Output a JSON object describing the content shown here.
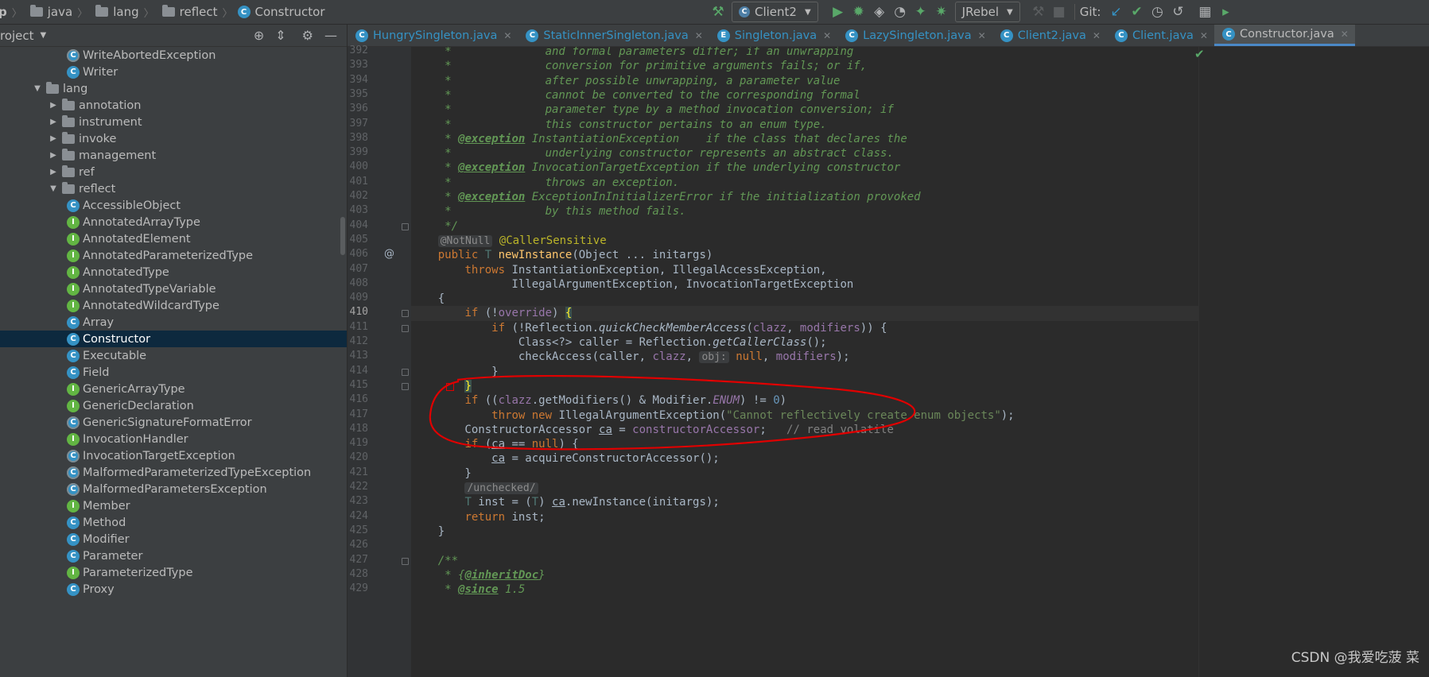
{
  "breadcrumbs": [
    "p",
    "java",
    "lang",
    "reflect",
    "Constructor"
  ],
  "toolbar": {
    "run_config": "Client2",
    "jrebel": "JRebel",
    "git_label": "Git:"
  },
  "project_panel": {
    "title": "roject",
    "tree": [
      {
        "label": "WriteAbortedException",
        "icon": "exception-class",
        "glyph": "C",
        "depth": 4,
        "arrow": ""
      },
      {
        "label": "Writer",
        "icon": "abstract-class",
        "glyph": "C",
        "depth": 4,
        "arrow": ""
      },
      {
        "label": "lang",
        "icon": "package",
        "glyph": "",
        "depth": 2,
        "arrow": "▼"
      },
      {
        "label": "annotation",
        "icon": "package",
        "glyph": "",
        "depth": 3,
        "arrow": "▶"
      },
      {
        "label": "instrument",
        "icon": "package",
        "glyph": "",
        "depth": 3,
        "arrow": "▶"
      },
      {
        "label": "invoke",
        "icon": "package",
        "glyph": "",
        "depth": 3,
        "arrow": "▶"
      },
      {
        "label": "management",
        "icon": "package",
        "glyph": "",
        "depth": 3,
        "arrow": "▶"
      },
      {
        "label": "ref",
        "icon": "package",
        "glyph": "",
        "depth": 3,
        "arrow": "▶"
      },
      {
        "label": "reflect",
        "icon": "package",
        "glyph": "",
        "depth": 3,
        "arrow": "▼"
      },
      {
        "label": "AccessibleObject",
        "icon": "class",
        "glyph": "C",
        "depth": 4,
        "arrow": ""
      },
      {
        "label": "AnnotatedArrayType",
        "icon": "interface",
        "glyph": "I",
        "depth": 4,
        "arrow": ""
      },
      {
        "label": "AnnotatedElement",
        "icon": "interface",
        "glyph": "I",
        "depth": 4,
        "arrow": ""
      },
      {
        "label": "AnnotatedParameterizedType",
        "icon": "interface",
        "glyph": "I",
        "depth": 4,
        "arrow": ""
      },
      {
        "label": "AnnotatedType",
        "icon": "interface",
        "glyph": "I",
        "depth": 4,
        "arrow": ""
      },
      {
        "label": "AnnotatedTypeVariable",
        "icon": "interface",
        "glyph": "I",
        "depth": 4,
        "arrow": ""
      },
      {
        "label": "AnnotatedWildcardType",
        "icon": "interface",
        "glyph": "I",
        "depth": 4,
        "arrow": ""
      },
      {
        "label": "Array",
        "icon": "class",
        "glyph": "C",
        "depth": 4,
        "arrow": ""
      },
      {
        "label": "Constructor",
        "icon": "class",
        "glyph": "C",
        "depth": 4,
        "arrow": "",
        "selected": true
      },
      {
        "label": "Executable",
        "icon": "abstract-class",
        "glyph": "C",
        "depth": 4,
        "arrow": ""
      },
      {
        "label": "Field",
        "icon": "class",
        "glyph": "C",
        "depth": 4,
        "arrow": ""
      },
      {
        "label": "GenericArrayType",
        "icon": "interface",
        "glyph": "I",
        "depth": 4,
        "arrow": ""
      },
      {
        "label": "GenericDeclaration",
        "icon": "interface",
        "glyph": "I",
        "depth": 4,
        "arrow": ""
      },
      {
        "label": "GenericSignatureFormatError",
        "icon": "exception-class",
        "glyph": "C",
        "depth": 4,
        "arrow": ""
      },
      {
        "label": "InvocationHandler",
        "icon": "interface",
        "glyph": "I",
        "depth": 4,
        "arrow": ""
      },
      {
        "label": "InvocationTargetException",
        "icon": "exception-class",
        "glyph": "C",
        "depth": 4,
        "arrow": ""
      },
      {
        "label": "MalformedParameterizedTypeException",
        "icon": "exception-class",
        "glyph": "C",
        "depth": 4,
        "arrow": ""
      },
      {
        "label": "MalformedParametersException",
        "icon": "exception-class",
        "glyph": "C",
        "depth": 4,
        "arrow": ""
      },
      {
        "label": "Member",
        "icon": "interface",
        "glyph": "I",
        "depth": 4,
        "arrow": ""
      },
      {
        "label": "Method",
        "icon": "class",
        "glyph": "C",
        "depth": 4,
        "arrow": ""
      },
      {
        "label": "Modifier",
        "icon": "class",
        "glyph": "C",
        "depth": 4,
        "arrow": ""
      },
      {
        "label": "Parameter",
        "icon": "class",
        "glyph": "C",
        "depth": 4,
        "arrow": ""
      },
      {
        "label": "ParameterizedType",
        "icon": "interface",
        "glyph": "I",
        "depth": 4,
        "arrow": ""
      },
      {
        "label": "Proxy",
        "icon": "class",
        "glyph": "C",
        "depth": 4,
        "arrow": ""
      }
    ]
  },
  "tabs": [
    {
      "label": "HungrySingleton.java",
      "glyph": "C",
      "active": false
    },
    {
      "label": "StaticInnerSingleton.java",
      "glyph": "C",
      "active": false
    },
    {
      "label": "Singleton.java",
      "glyph": "E",
      "active": false
    },
    {
      "label": "LazySingleton.java",
      "glyph": "C",
      "active": false
    },
    {
      "label": "Client2.java",
      "glyph": "C",
      "active": false
    },
    {
      "label": "Client.java",
      "glyph": "C",
      "active": false
    },
    {
      "label": "Constructor.java",
      "glyph": "C",
      "active": true
    }
  ],
  "editor": {
    "lines": [
      {
        "n": "392",
        "html": "<span class='cm'>     *              and formal parameters differ; if an unwrapping</span>"
      },
      {
        "n": "393",
        "html": "<span class='cm'>     *              conversion for primitive arguments fails; or if,</span>"
      },
      {
        "n": "394",
        "html": "<span class='cm'>     *              after possible unwrapping, a parameter value</span>"
      },
      {
        "n": "395",
        "html": "<span class='cm'>     *              cannot be converted to the corresponding formal</span>"
      },
      {
        "n": "396",
        "html": "<span class='cm'>     *              parameter type by a method invocation conversion; if</span>"
      },
      {
        "n": "397",
        "html": "<span class='cm'>     *              this constructor pertains to an enum type.</span>"
      },
      {
        "n": "398",
        "html": "<span class='cm'>     * </span><span class='tag'>@exception</span><span class='cm'> InstantiationException    if the class that declares the</span>"
      },
      {
        "n": "399",
        "html": "<span class='cm'>     *              underlying constructor represents an abstract class.</span>"
      },
      {
        "n": "400",
        "html": "<span class='cm'>     * </span><span class='tag'>@exception</span><span class='cm'> InvocationTargetException if the underlying constructor</span>"
      },
      {
        "n": "401",
        "html": "<span class='cm'>     *              throws an exception.</span>"
      },
      {
        "n": "402",
        "html": "<span class='cm'>     * </span><span class='tag'>@exception</span><span class='cm'> ExceptionInInitializerError if the initialization provoked</span>"
      },
      {
        "n": "403",
        "html": "<span class='cm'>     *              by this method fails.</span>"
      },
      {
        "n": "404",
        "html": "<span class='cm'>     */</span>"
      },
      {
        "n": "405",
        "html": "    <span class='hint'>@NotNull</span> <span class='an'>@CallerSensitive</span>"
      },
      {
        "n": "406",
        "html": "    <span class='kw'>public</span> <span style='color:#507874'>T</span> <span class='fn'>newInstance</span>(Object ... initargs)"
      },
      {
        "n": "407",
        "html": "        <span class='kw'>throws</span> InstantiationException, IllegalAccessException,"
      },
      {
        "n": "408",
        "html": "               IllegalArgumentException, InvocationTargetException"
      },
      {
        "n": "409",
        "html": "    {"
      },
      {
        "n": "410",
        "html": "        <span class='kw'>if</span> (!<span class='fld'>override</span>) <span class='brace'>{</span>"
      },
      {
        "n": "411",
        "html": "            <span class='kw'>if</span> (!Reflection.<span class='it'>quickCheckMemberAccess</span>(<span class='fld'>clazz</span>, <span class='fld'>modifiers</span>)) {"
      },
      {
        "n": "412",
        "html": "                Class&lt;?&gt; caller = Reflection.<span class='it'>getCallerClass</span>();"
      },
      {
        "n": "413",
        "html": "                checkAccess(caller, <span class='fld'>clazz</span>, <span class='hint'>obj:</span> <span class='kw'>null</span>, <span class='fld'>modifiers</span>);"
      },
      {
        "n": "414",
        "html": "            }"
      },
      {
        "n": "415",
        "html": "        <span class='brace'>}</span>"
      },
      {
        "n": "416",
        "html": "        <span class='kw'>if</span> ((<span class='fld'>clazz</span>.getModifiers() &amp; Modifier.<span class='fld it'>ENUM</span>) != <span class='nu'>0</span>)"
      },
      {
        "n": "417",
        "html": "            <span class='kw'>throw new</span> IllegalArgumentException(<span class='st'>\"Cannot reflectively create enum objects\"</span>);"
      },
      {
        "n": "418",
        "html": "        ConstructorAccessor <span class='ul'>ca</span> = <span class='fld'>constructorAccessor</span>;   <span class='lc'>// read volatile</span>"
      },
      {
        "n": "419",
        "html": "        <span class='kw'>if</span> (<span class='ul'>ca</span> == <span class='kw'>null</span>) {"
      },
      {
        "n": "420",
        "html": "            <span class='ul'>ca</span> = acquireConstructorAccessor();"
      },
      {
        "n": "421",
        "html": "        }"
      },
      {
        "n": "422",
        "html": "        <span class='hint'>/unchecked/</span>"
      },
      {
        "n": "423",
        "html": "        <span style='color:#507874'>T</span> inst = (<span style='color:#507874'>T</span>) <span class='ul'>ca</span>.newInstance(initargs);"
      },
      {
        "n": "424",
        "html": "        <span class='kw'>return</span> inst;"
      },
      {
        "n": "425",
        "html": "    }"
      },
      {
        "n": "426",
        "html": ""
      },
      {
        "n": "427",
        "html": "<span class='cm'>    /**</span>"
      },
      {
        "n": "428",
        "html": "<span class='cm'>     * {</span><span class='tag'>@inheritDoc</span><span class='cm'>}</span>"
      },
      {
        "n": "429",
        "html": "<span class='cm'>     * </span><span class='tag'>@since</span><span class='cm'> 1.5</span>"
      }
    ]
  },
  "watermark": "CSDN @我爱吃菠 菜",
  "colors": {
    "annotation_circle": "#e00000",
    "selection": "#0d293e",
    "tab_underline": "#4a88c7"
  }
}
